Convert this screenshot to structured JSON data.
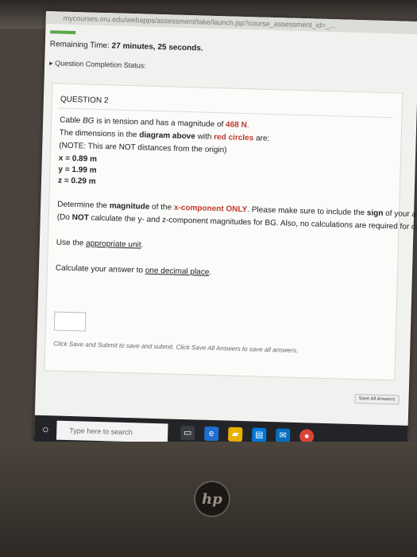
{
  "browser": {
    "url": "mycourses.oru.edu/webapps/assessment/take/launch.jsp?course_assessment_id=_..."
  },
  "timer": {
    "prefix": "Remaining Time:",
    "value": "27 minutes, 25 seconds."
  },
  "completion_status": "▸ Question Completion Status:",
  "question": {
    "title": "QUESTION 2",
    "line1_a": "Cable ",
    "line1_var": "BG",
    "line1_b": " is in tension and has a magnitude of ",
    "line1_mag": "468 N",
    "line1_c": ".",
    "line2_a": "The dimensions in the ",
    "line2_bold": "diagram above",
    "line2_b": " with ",
    "line2_red": "red circles",
    "line2_c": " are:",
    "note": "(NOTE: This are NOT distances from the origin)",
    "dims": [
      "x = 0.89 m",
      "y = 1.99 m",
      "z = 0.29 m"
    ],
    "instr_a": "Determine the ",
    "instr_bold1": "magnitude",
    "instr_b": " of the ",
    "instr_red": "x-component ONLY",
    "instr_c": ". Please make sure to include the ",
    "instr_bold2": "sign",
    "instr_d": " of your answer, if it is negative.",
    "instr2_a": "(Do ",
    "instr2_bold": "NOT",
    "instr2_b": " calculate the y- and z-component magnitudes for BG. Also, no calculations are required for cable BH!)",
    "unit_a": "Use the ",
    "unit_u": "appropriate unit",
    "unit_b": ".",
    "calc_a": "Calculate your answer to ",
    "calc_u": "one decimal place",
    "calc_b": "."
  },
  "footer_note": "Click Save and Submit to save and submit. Click Save All Answers to save all answers.",
  "save_all_button": "Save All Answers",
  "taskbar": {
    "search_placeholder": "Type here to search"
  },
  "hp_logo": "hp"
}
